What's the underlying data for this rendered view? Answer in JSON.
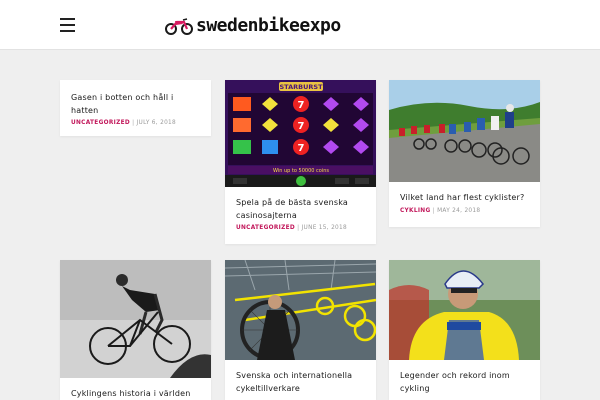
{
  "header": {
    "logo_text": "swedenbikeexpo",
    "logo_color": "#d81b60"
  },
  "posts": [
    {
      "title": "Gasen i botten och håll i hatten",
      "category": "UNCATEGORIZED",
      "date": "JULY 6, 2018",
      "has_image": false
    },
    {
      "title": "Spela på de bästa svenska casinosajterna",
      "category": "UNCATEGORIZED",
      "date": "JUNE 15, 2018",
      "has_image": true,
      "image": {
        "game_title": "STARBURST",
        "banner_text": "Win up to 50000 coins"
      }
    },
    {
      "title": "Vilket land har flest cyklister?",
      "category": "CYKLING",
      "date": "MAY 24, 2018",
      "has_image": true
    },
    {
      "title": "Cyklingens historia i världen",
      "category": "",
      "date": "",
      "has_image": true
    },
    {
      "title": "Svenska och internationella cykeltillverkare",
      "category": "",
      "date": "",
      "has_image": true
    },
    {
      "title": "Legender och rekord inom cykling",
      "category": "",
      "date": "",
      "has_image": true
    }
  ]
}
